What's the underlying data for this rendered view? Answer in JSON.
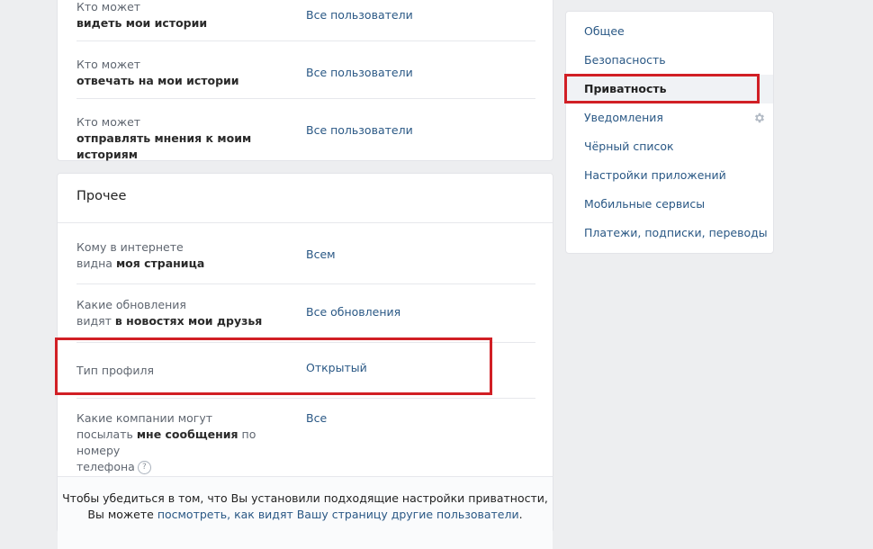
{
  "stories_section": {
    "rows": [
      {
        "label_plain": "Кто может",
        "label_bold": "видеть мои истории",
        "value": "Все пользователи"
      },
      {
        "label_plain": "Кто может",
        "label_bold": "отвечать на мои истории",
        "value": "Все пользователи"
      },
      {
        "label_plain": "Кто может",
        "label_bold": "отправлять мнения к моим историям",
        "value": "Все пользователи"
      }
    ]
  },
  "other_section": {
    "title": "Прочее",
    "rows": [
      {
        "line1": "Кому в интернете",
        "line2_plain": "видна ",
        "line2_bold": "моя страница",
        "value": "Всем"
      },
      {
        "line1": "Какие обновления",
        "line2_plain": "видят ",
        "line2_bold": "в новостях мои друзья",
        "value": "Все обновления"
      },
      {
        "line1": "Тип профиля",
        "value": "Открытый"
      },
      {
        "line1": "Какие компании могут",
        "line2_plain": "посылать ",
        "line2_bold": "мне сообщения",
        "line2_tail": " по номеру",
        "line3": "телефона",
        "help": "?",
        "value": "Все"
      }
    ],
    "footer": {
      "line1": "Чтобы убедиться в том, что Вы установили подходящие настройки приватности,",
      "line2_prefix": "Вы можете ",
      "line2_link": "посмотреть, как видят Вашу страницу другие пользователи",
      "line2_suffix": "."
    }
  },
  "settings_menu": {
    "items": [
      {
        "label": "Общее"
      },
      {
        "label": "Безопасность"
      },
      {
        "label": "Приватность",
        "active": true
      },
      {
        "label": "Уведомления",
        "icon": "gear-icon"
      },
      {
        "label": "Чёрный список"
      },
      {
        "label": "Настройки приложений"
      },
      {
        "label": "Мобильные сервисы"
      },
      {
        "label": "Платежи, подписки, переводы"
      }
    ]
  },
  "colors": {
    "accent_link": "#2a5885",
    "highlight": "#d11f25",
    "background": "#edeef0"
  }
}
